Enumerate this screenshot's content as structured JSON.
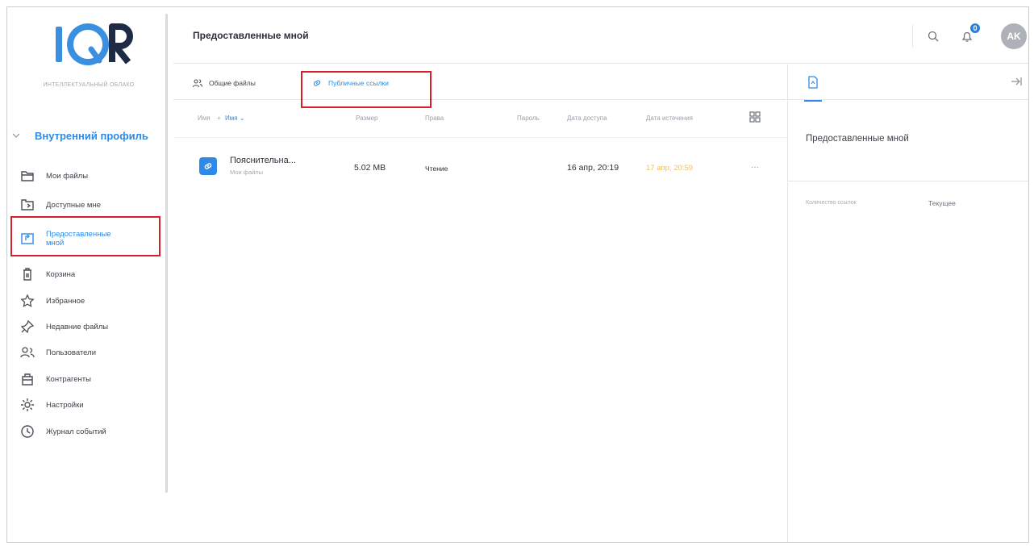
{
  "app": {
    "logo_text": "IQR",
    "logo_subtitle": "ИНТЕЛЛЕКТУАЛЬНЫЙ ОБЛАКО"
  },
  "sidebar": {
    "profile_label": "Внутренний профиль",
    "items": [
      {
        "label": "Мои файлы",
        "icon": "folder-icon"
      },
      {
        "label": "Доступные мне",
        "icon": "shared-folder-icon"
      },
      {
        "label": "Предоставленные мной",
        "icon": "share-out-icon"
      },
      {
        "label": "Корзина",
        "icon": "trash-icon"
      },
      {
        "label": "Избранное",
        "icon": "star-icon"
      },
      {
        "label": "Недавние файлы",
        "icon": "pin-icon"
      },
      {
        "label": "Пользователи",
        "icon": "users-icon"
      },
      {
        "label": "Контрагенты",
        "icon": "contractors-icon"
      },
      {
        "label": "Настройки",
        "icon": "gear-icon"
      },
      {
        "label": "Журнал событий",
        "icon": "clock-icon"
      }
    ]
  },
  "header": {
    "title": "Предоставленные мной",
    "notification_count": "0",
    "avatar_initials": "AK"
  },
  "tabs": [
    {
      "label": "Общие файлы"
    },
    {
      "label": "Публичные ссылки"
    }
  ],
  "table": {
    "columns": {
      "type": "Имя",
      "name": "Имя",
      "size": "Размер",
      "rights": "Права",
      "password": "Пароль",
      "access_date": "Дата доступа",
      "expiry_date": "Дата истечения"
    },
    "rows": [
      {
        "name": "Пояснительна...",
        "folder": "Мои файлы",
        "size": "5.02 MB",
        "rights": "Чтение",
        "access_date": "16 апр, 20:19",
        "expiry_date": "17 апр, 20:59",
        "more": "···"
      }
    ]
  },
  "panel": {
    "title": "Предоставленные мной",
    "prop_label": "Количество ссылок",
    "prop_value": "Текущее"
  },
  "colors": {
    "accent": "#2e8ae6",
    "highlight": "#d61f2c",
    "expiry": "#f0c25a",
    "badge": "#2e7fd9"
  }
}
